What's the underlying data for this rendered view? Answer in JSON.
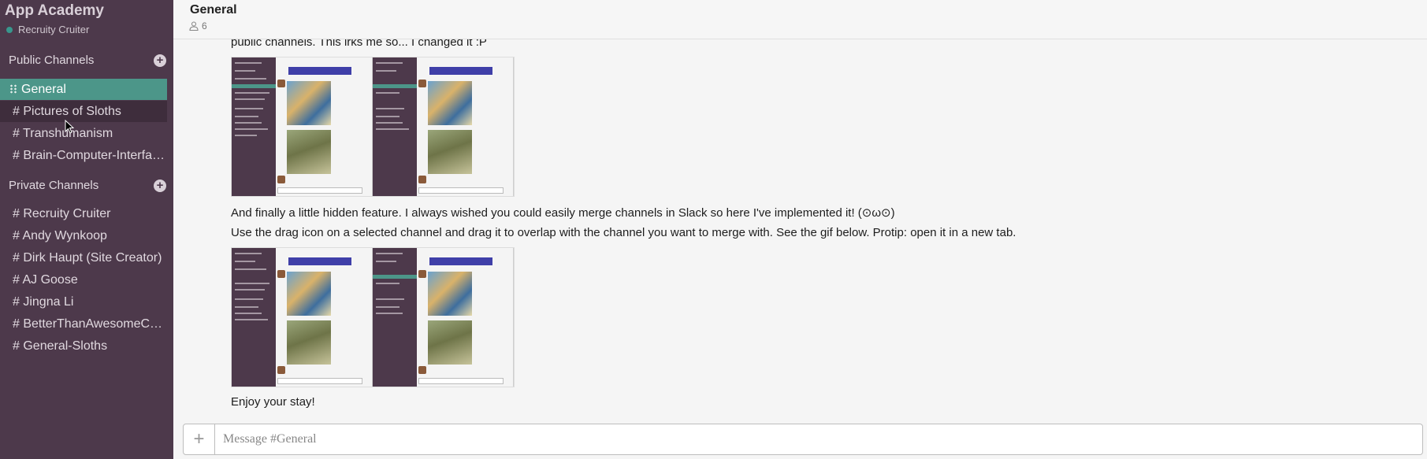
{
  "sidebar": {
    "team_name": "App Academy",
    "user_name": "Recruity Cruiter",
    "public_header": "Public Channels",
    "public_channels": [
      {
        "label": "General"
      },
      {
        "label": "# Pictures of Sloths"
      },
      {
        "label": "# Transhumanism"
      },
      {
        "label": "# Brain-Computer-Interfaces"
      }
    ],
    "private_header": "Private Channels",
    "private_channels": [
      {
        "label": "# Recruity Cruiter"
      },
      {
        "label": "# Andy Wynkoop"
      },
      {
        "label": "# Dirk Haupt (Site Creator)"
      },
      {
        "label": "# AJ Goose"
      },
      {
        "label": "# Jingna Li"
      },
      {
        "label": "# BetterThanAwesomeChannel"
      },
      {
        "label": "# General-Sloths"
      }
    ],
    "add_icon": "+"
  },
  "header": {
    "title": "General",
    "member_count": "6"
  },
  "messages": {
    "line1": "public channels. This irks me so... I changed it :P",
    "line2": "And finally a little hidden feature. I always wished you could easily merge channels in Slack so here I've implemented it! (⊙ω⊙)",
    "line3": "Use the drag icon on a selected channel and drag it to overlap with the channel you want to merge with. See the gif below. Protip: open it in a new tab.",
    "line4": "Enjoy your stay!"
  },
  "composer": {
    "plus": "+",
    "placeholder": "Message #General"
  },
  "colors": {
    "sidebar_bg": "#4d394b",
    "active_channel": "#4c9689",
    "presence": "#38978d"
  }
}
